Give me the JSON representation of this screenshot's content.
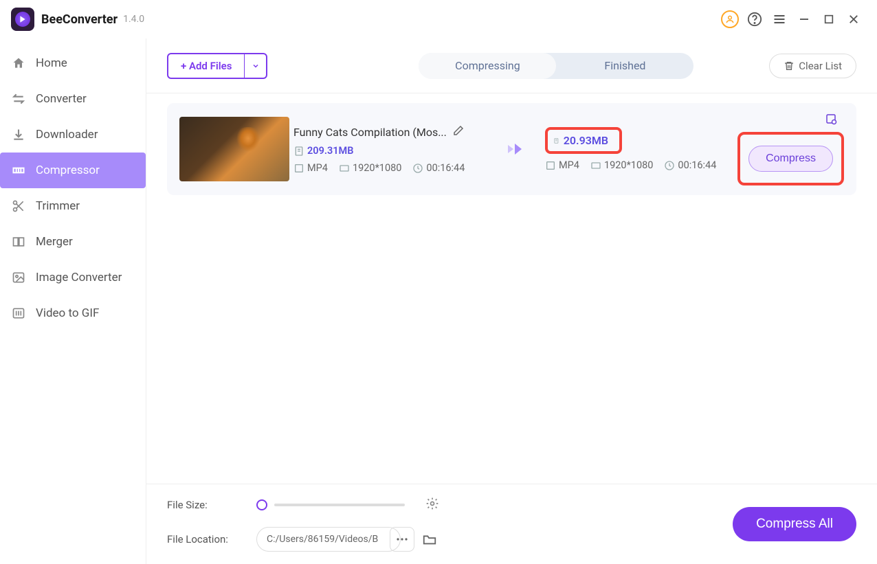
{
  "app": {
    "name": "BeeConverter",
    "version": "1.4.0"
  },
  "sidebar": {
    "items": [
      {
        "label": "Home"
      },
      {
        "label": "Converter"
      },
      {
        "label": "Downloader"
      },
      {
        "label": "Compressor"
      },
      {
        "label": "Trimmer"
      },
      {
        "label": "Merger"
      },
      {
        "label": "Image Converter"
      },
      {
        "label": "Video to GIF"
      }
    ]
  },
  "toolbar": {
    "add_files": "+ Add Files",
    "tab_compressing": "Compressing",
    "tab_finished": "Finished",
    "clear_list": "Clear List"
  },
  "item": {
    "title": "Funny Cats Compilation (Mos...",
    "src": {
      "size": "209.31MB",
      "format": "MP4",
      "resolution": "1920*1080",
      "duration": "00:16:44"
    },
    "dst": {
      "size": "20.93MB",
      "format": "MP4",
      "resolution": "1920*1080",
      "duration": "00:16:44"
    },
    "compress_btn": "Compress"
  },
  "footer": {
    "file_size_label": "File Size:",
    "file_location_label": "File Location:",
    "file_location_value": "C:/Users/86159/Videos/B",
    "compress_all": "Compress All"
  }
}
